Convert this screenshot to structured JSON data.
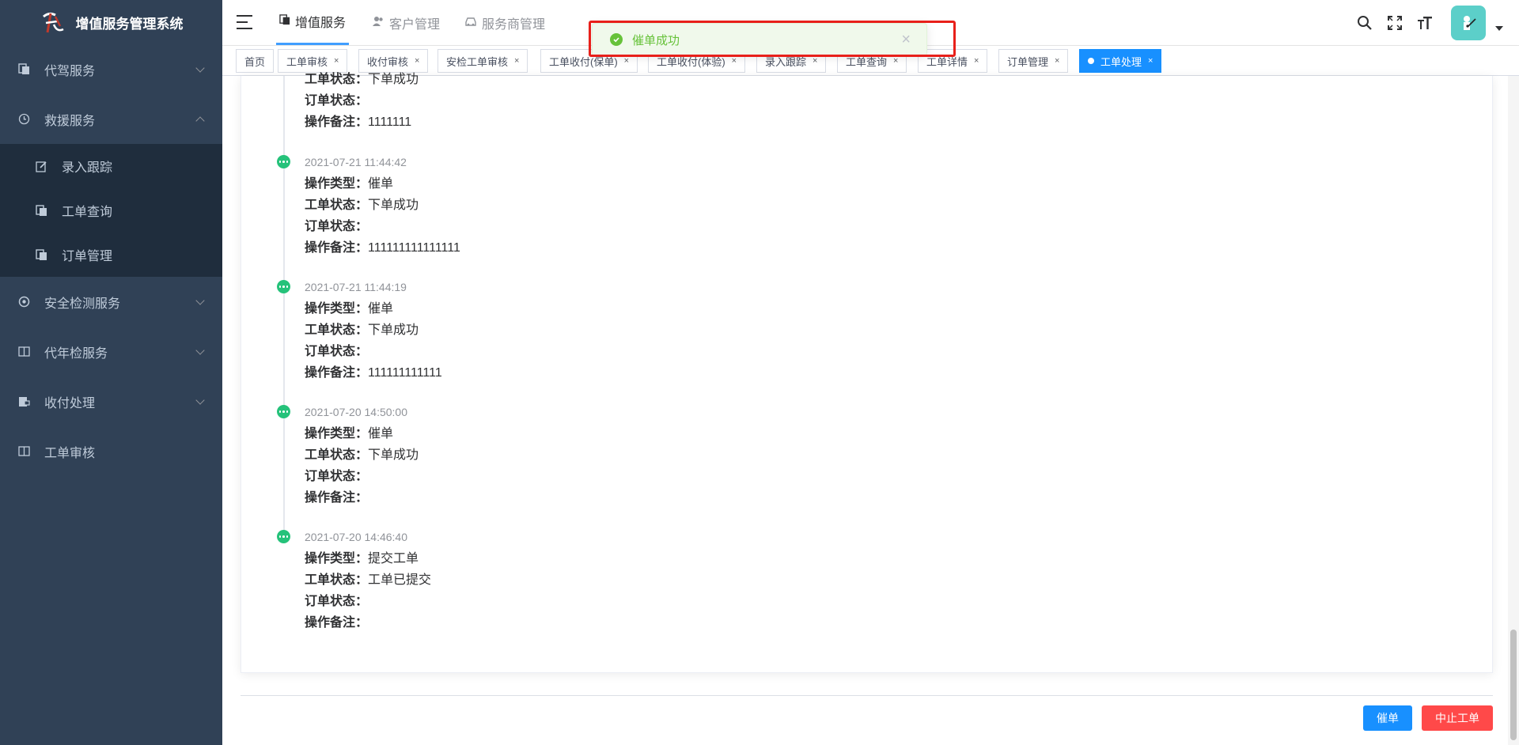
{
  "app": {
    "title": "增值服务管理系统"
  },
  "sidebar": {
    "items": [
      {
        "label": "代驾服务",
        "icon": "copy-icon"
      },
      {
        "label": "救援服务",
        "icon": "clock-icon"
      },
      {
        "label": "安全检测服务",
        "icon": "aperture-icon"
      },
      {
        "label": "代年检服务",
        "icon": "book-icon"
      },
      {
        "label": "收付处理",
        "icon": "wallet-icon"
      },
      {
        "label": "工单审核",
        "icon": "book-icon"
      }
    ],
    "submenu": [
      {
        "label": "录入跟踪",
        "icon": "edit-icon"
      },
      {
        "label": "工单查询",
        "icon": "copy-icon"
      },
      {
        "label": "订单管理",
        "icon": "copy-icon"
      }
    ]
  },
  "topnav": {
    "tabs": [
      {
        "label": "增值服务",
        "icon": "copy-icon",
        "active": true
      },
      {
        "label": "客户管理",
        "icon": "user-group-icon"
      },
      {
        "label": "服务商管理",
        "icon": "car-icon"
      }
    ]
  },
  "tags": [
    {
      "label": "首页",
      "closable": false
    },
    {
      "label": "工单审核",
      "closable": true
    },
    {
      "label": "收付审核",
      "closable": true
    },
    {
      "label": "安检工单审核",
      "closable": true
    },
    {
      "label": "工单收付(保单)",
      "closable": true
    },
    {
      "label": "工单收付(体验)",
      "closable": true
    },
    {
      "label": "录入跟踪",
      "closable": true
    },
    {
      "label": "工单查询",
      "closable": true
    },
    {
      "label": "工单详情",
      "closable": true
    },
    {
      "label": "订单管理",
      "closable": true
    },
    {
      "label": "工单处理",
      "closable": true,
      "active": true
    }
  ],
  "fields": {
    "op_type": "操作类型：",
    "ticket_status": "工单状态：",
    "order_status": "订单状态：",
    "remark": "操作备注："
  },
  "timeline": [
    {
      "time": "",
      "op_type": "",
      "ticket_status": "下单成功",
      "order_status": "",
      "remark": "1111111"
    },
    {
      "time": "2021-07-21 11:44:42",
      "op_type": "催单",
      "ticket_status": "下单成功",
      "order_status": "",
      "remark": "111111111111111"
    },
    {
      "time": "2021-07-21 11:44:19",
      "op_type": "催单",
      "ticket_status": "下单成功",
      "order_status": "",
      "remark": "111111111111"
    },
    {
      "time": "2021-07-20 14:50:00",
      "op_type": "催单",
      "ticket_status": "下单成功",
      "order_status": "",
      "remark": ""
    },
    {
      "time": "2021-07-20 14:46:40",
      "op_type": "提交工单",
      "ticket_status": "工单已提交",
      "order_status": "",
      "remark": ""
    }
  ],
  "actions": {
    "urge": "催单",
    "stop": "中止工单"
  },
  "toast": {
    "message": "催单成功",
    "type": "success"
  },
  "colors": {
    "sidebar": "#304156",
    "primary": "#1890ff",
    "danger": "#ff4949",
    "success": "#67c23a",
    "timeline_dot": "#25c27a",
    "highlight": "#e8201a"
  }
}
